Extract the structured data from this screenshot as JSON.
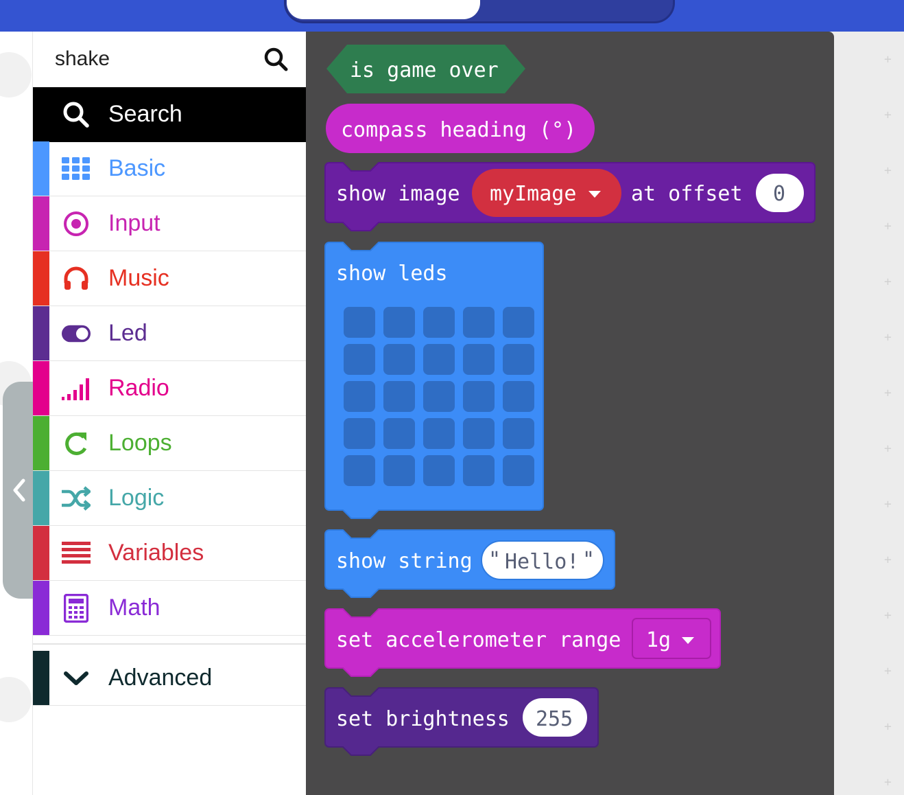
{
  "search": {
    "value": "shake"
  },
  "toolbox": {
    "search_label": "Search",
    "categories": [
      {
        "label": "Basic",
        "color": "#4C97FF",
        "icon": "grid-icon"
      },
      {
        "label": "Input",
        "color": "#C724B1",
        "icon": "target-icon"
      },
      {
        "label": "Music",
        "color": "#E63022",
        "icon": "headphones-icon"
      },
      {
        "label": "Led",
        "color": "#5C2D91",
        "icon": "toggle-icon"
      },
      {
        "label": "Radio",
        "color": "#E3008C",
        "icon": "signal-bars-icon"
      },
      {
        "label": "Loops",
        "color": "#00AA00",
        "icon": "refresh-icon"
      },
      {
        "label": "Logic",
        "color": "#00A4A6",
        "icon": "shuffle-icon"
      },
      {
        "label": "Variables",
        "color": "#DC143C",
        "icon": "lines-icon"
      },
      {
        "label": "Math",
        "color": "#9400D3",
        "icon": "calculator-icon"
      }
    ],
    "advanced_label": "Advanced"
  },
  "blocks": {
    "is_game_over": "is game over",
    "compass_heading": "compass heading (°)",
    "show_image": "show image",
    "my_image": "myImage",
    "at_offset": "at offset",
    "offset_value": "0",
    "show_leds": "show leds",
    "show_string": "show string",
    "string_value": "Hello!",
    "set_accel_range": "set accelerometer range",
    "accel_value": "1g",
    "set_brightness": "set brightness",
    "brightness_value": "255"
  },
  "colors": {
    "topbar": "#3454D1",
    "flyout": "#4A494A",
    "game_block": "#2E7D4F",
    "input_block": "#C72BCB",
    "led_block": "#6A1FA1",
    "basic_block": "#3C8CF7",
    "brightness_block": "#55288F",
    "variable_pill": "#D23040"
  }
}
